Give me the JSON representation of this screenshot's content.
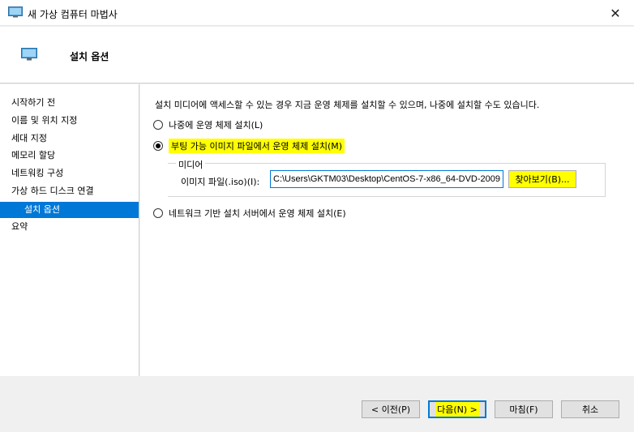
{
  "window": {
    "title": "새 가상 컴퓨터 마법사",
    "close_glyph": "✕"
  },
  "header": {
    "page_title": "설치 옵션"
  },
  "sidebar": {
    "items": [
      {
        "label": "시작하기 전"
      },
      {
        "label": "이름 및 위치 지정"
      },
      {
        "label": "세대 지정"
      },
      {
        "label": "메모리 할당"
      },
      {
        "label": "네트워킹 구성"
      },
      {
        "label": "가상 하드 디스크 연결"
      },
      {
        "label": "설치 옵션",
        "active": true
      },
      {
        "label": "요약"
      }
    ]
  },
  "main": {
    "description": "설치 미디어에 액세스할 수 있는 경우 지금 운영 체제를 설치할 수 있으며, 나중에 설치할 수도 있습니다.",
    "options": [
      {
        "label": "나중에 운영 체제 설치(L)",
        "checked": false
      },
      {
        "label": "부팅 가능 이미지 파일에서 운영 체제 설치(M)",
        "checked": true
      },
      {
        "label": "네트워크 기반 설치 서버에서 운영 체제 설치(E)",
        "checked": false
      }
    ],
    "media": {
      "group_label": "미디어",
      "iso_label": "이미지 파일(.iso)(I):",
      "iso_value": "C:\\Users\\GKTM03\\Desktop\\CentOS-7-x86_64-DVD-2009.iso",
      "browse_label": "찾아보기(B)..."
    }
  },
  "footer": {
    "prev_label": "< 이전(P)",
    "next_label": "다음(N) >",
    "finish_label": "마침(F)",
    "cancel_label": "취소"
  },
  "colors": {
    "accent": "#0078d7",
    "highlight": "#ffff00"
  }
}
